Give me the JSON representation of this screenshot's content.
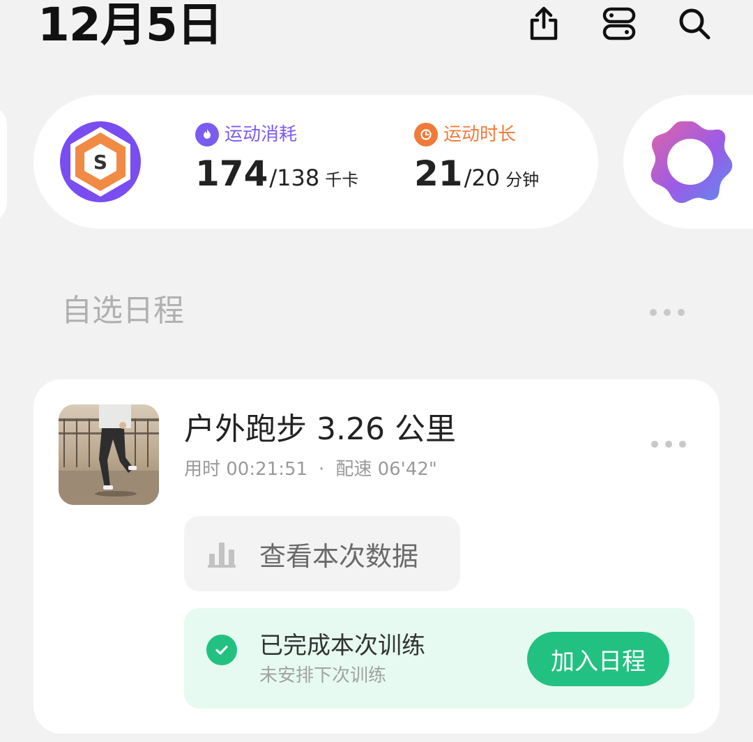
{
  "header": {
    "date": "12月5日",
    "icons": [
      "share-icon",
      "layout-toggle-icon",
      "search-icon"
    ]
  },
  "stats": {
    "calories": {
      "label": "运动消耗",
      "value": "174",
      "goal": "/138",
      "unit": "千卡",
      "color": "#7b5cf0",
      "icon": "flame-icon"
    },
    "duration": {
      "label": "运动时长",
      "value": "21",
      "goal": "/20",
      "unit": "分钟",
      "color": "#f07a3a",
      "icon": "clock-icon"
    },
    "badge_letter": "S"
  },
  "section": {
    "title": "自选日程"
  },
  "workout": {
    "title": "户外跑步 3.26 公里",
    "duration_label": "用时 00:21:51",
    "separator": "·",
    "pace_label": "配速 06'42\"",
    "view_data_label": "查看本次数据",
    "completed_title": "已完成本次训练",
    "completed_sub": "未安排下次训练",
    "add_button": "加入日程",
    "accent": "#23c181"
  }
}
